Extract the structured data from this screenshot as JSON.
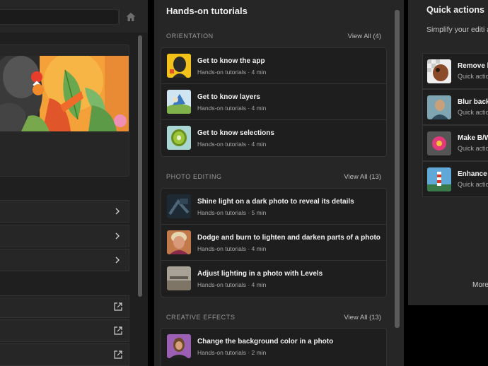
{
  "middle": {
    "title": "Hands-on tutorials",
    "sections": [
      {
        "heading": "ORIENTATION",
        "view_all": "View All (4)",
        "items": [
          {
            "title": "Get to know the app",
            "meta": "Hands-on tutorials  ·  4 min"
          },
          {
            "title": "Get to know layers",
            "meta": "Hands-on tutorials  ·  4 min"
          },
          {
            "title": "Get to know selections",
            "meta": "Hands-on tutorials  ·  4 min"
          }
        ]
      },
      {
        "heading": "PHOTO EDITING",
        "view_all": "View All (13)",
        "items": [
          {
            "title": "Shine light on a dark photo to reveal its details",
            "meta": "Hands-on tutorials  ·  5 min"
          },
          {
            "title": "Dodge and burn to lighten and darken parts of a photo",
            "meta": "Hands-on tutorials  ·  4 min"
          },
          {
            "title": "Adjust lighting in a photo with Levels",
            "meta": "Hands-on tutorials  ·  4 min"
          }
        ]
      },
      {
        "heading": "CREATIVE EFFECTS",
        "view_all": "View All (13)",
        "items": [
          {
            "title": "Change the background color in a photo",
            "meta": "Hands-on tutorials  ·  2 min"
          }
        ]
      }
    ]
  },
  "right": {
    "title": "Quick actions",
    "description": "Simplify your editi actions",
    "actions": [
      {
        "title": "Remove b",
        "meta": "Quick actio"
      },
      {
        "title": "Blur back",
        "meta": "Quick actio"
      },
      {
        "title": "Make B/W",
        "meta": "Quick actio"
      },
      {
        "title": "Enhance I",
        "meta": "Quick actio"
      }
    ],
    "more": "More"
  },
  "icons": {
    "home": "home-icon",
    "chevron": "chevron-right-icon",
    "external": "external-link-icon"
  }
}
